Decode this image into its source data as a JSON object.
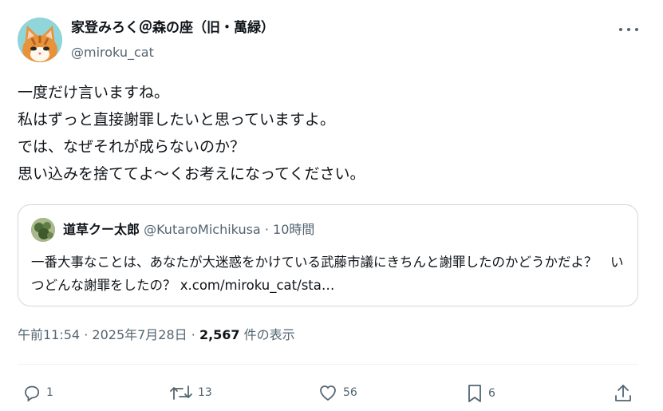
{
  "author": {
    "display_name": "家登みろく＠森の座（旧・萬緑）",
    "handle": "@miroku_cat",
    "avatar_icon": "cat-avatar-icon"
  },
  "tweet": {
    "lines": [
      "一度だけ言いますね。",
      "私はずっと直接謝罪したいと思っていますよ。",
      "では、なぜそれが成らないのか？",
      "思い込みを捨ててよ～くお考えになってください。"
    ]
  },
  "quote": {
    "name": "道草クー太郎",
    "handle": "@KutaroMichikusa",
    "separator": "·",
    "time": "10時間",
    "text": "一番大事なことは、あなたが大迷惑をかけている武藤市議にきちんと謝罪したのかどうかだよ？　いつどんな謝罪をしたの？ x.com/miroku_cat/sta…"
  },
  "meta": {
    "time": "午前11:54",
    "sep1": "·",
    "date": "2025年7月28日",
    "sep2": "·",
    "views": "2,567",
    "views_label": "件の表示"
  },
  "actions": {
    "reply_count": "1",
    "retweet_count": "13",
    "like_count": "56",
    "bookmark_count": "6"
  },
  "colors": {
    "secondary_text": "#536471",
    "border": "#cfd9de",
    "text": "#0f1419"
  }
}
